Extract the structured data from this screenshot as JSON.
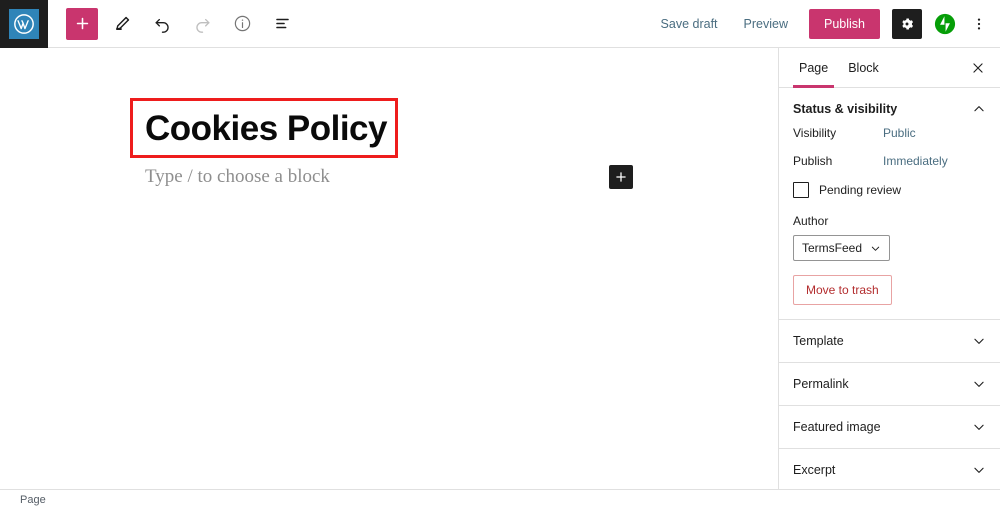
{
  "topbar": {
    "logo_name": "wordpress-logo",
    "tools": [
      {
        "name": "add-block-button",
        "icon": "plus-icon",
        "label": "Add block",
        "state": "primary"
      },
      {
        "name": "tools-button",
        "icon": "pencil-icon",
        "label": "Tools",
        "state": "normal"
      },
      {
        "name": "undo-button",
        "icon": "undo-icon",
        "label": "Undo",
        "state": "normal"
      },
      {
        "name": "redo-button",
        "icon": "redo-icon",
        "label": "Redo",
        "state": "disabled"
      },
      {
        "name": "details-button",
        "icon": "info-icon",
        "label": "Details",
        "state": "muted"
      },
      {
        "name": "list-view-button",
        "icon": "list-view-icon",
        "label": "List view",
        "state": "normal"
      }
    ],
    "save_draft_label": "Save draft",
    "preview_label": "Preview",
    "publish_label": "Publish",
    "settings_label": "Settings",
    "jetpack_label": "Jetpack",
    "more_label": "Options"
  },
  "editor": {
    "post_title": "Cookies Policy",
    "block_placeholder": "Type / to choose a block",
    "inserter_label": "Add block",
    "highlight_color": "#ee1d1d"
  },
  "sidebar": {
    "tabs": [
      {
        "label": "Page",
        "active": true
      },
      {
        "label": "Block",
        "active": false
      }
    ],
    "close_label": "Close settings",
    "status_panel": {
      "title": "Status & visibility",
      "expanded": true,
      "visibility_label": "Visibility",
      "visibility_value": "Public",
      "publish_label": "Publish",
      "publish_value": "Immediately",
      "pending_review_label": "Pending review",
      "pending_review_checked": false,
      "author_label": "Author",
      "author_value": "TermsFeed",
      "trash_label": "Move to trash"
    },
    "panels": [
      {
        "label": "Template",
        "expanded": false
      },
      {
        "label": "Permalink",
        "expanded": false
      },
      {
        "label": "Featured image",
        "expanded": false
      },
      {
        "label": "Excerpt",
        "expanded": false
      }
    ]
  },
  "bottombar": {
    "breadcrumb": "Page"
  },
  "colors": {
    "accent": "#c9356e",
    "link": "#4a6d80",
    "dark": "#1e1e1e",
    "danger": "#b32d2e",
    "jetpack_green": "#069e08",
    "wp_blue": "#2f84b8"
  }
}
